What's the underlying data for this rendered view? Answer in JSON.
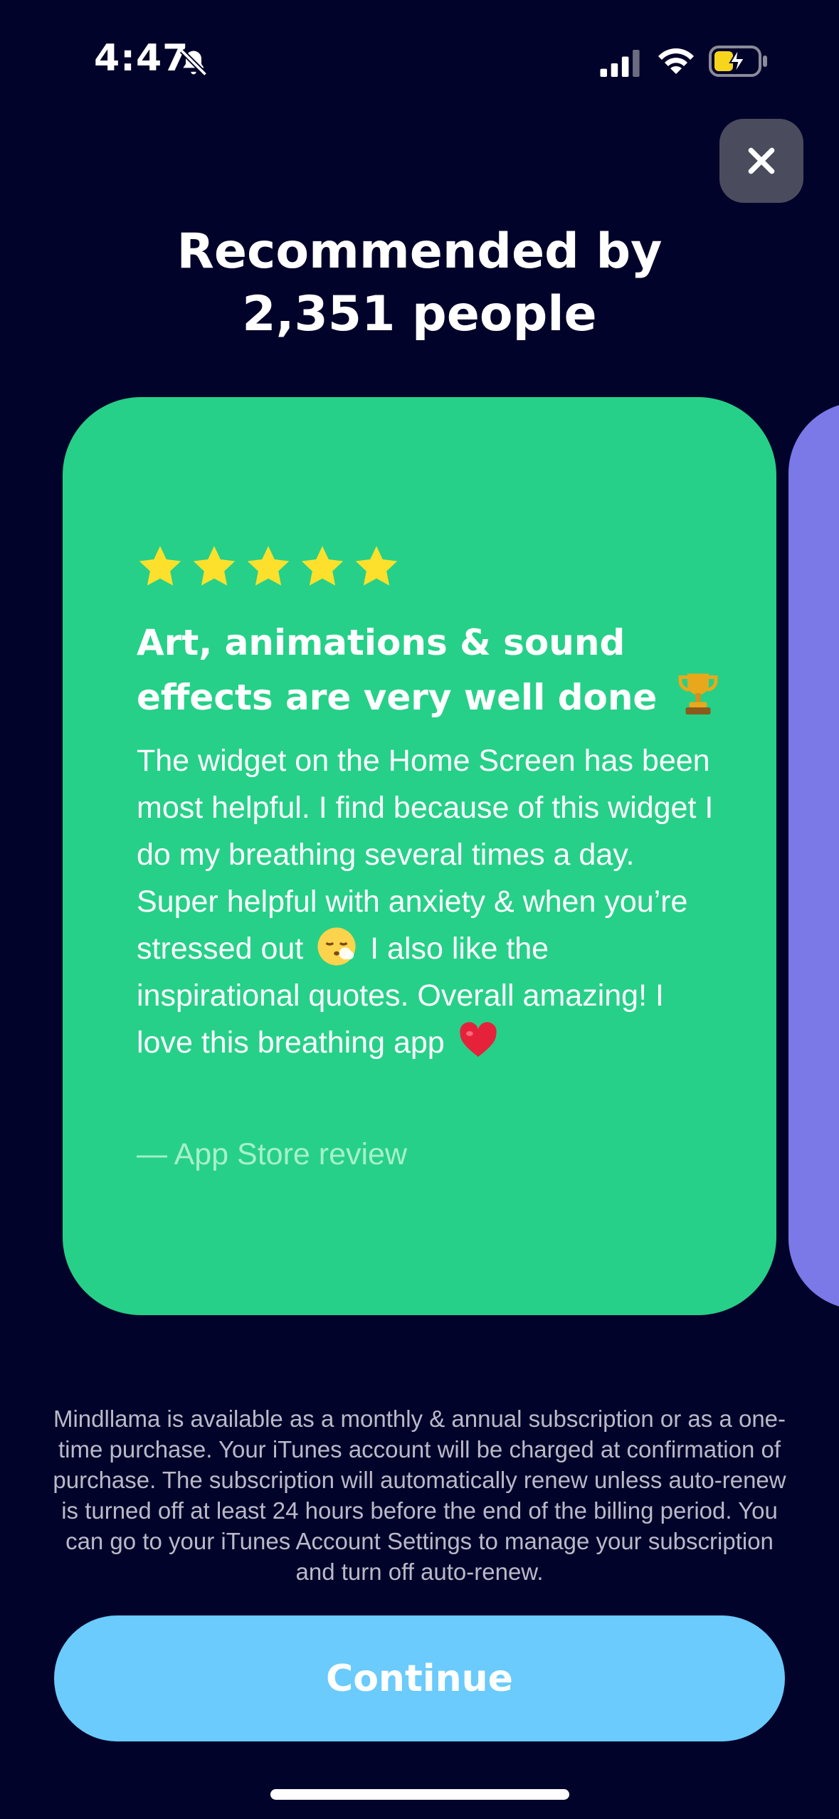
{
  "status_bar": {
    "time": "4:47",
    "icons": [
      "bell-slash-icon",
      "signal-icon",
      "wifi-icon",
      "battery-charging-icon"
    ],
    "battery_color": "#f7d51d"
  },
  "close": {
    "icon": "close-icon"
  },
  "header": {
    "title_line1": "Recommended by",
    "title_line2": "2,351 people"
  },
  "review": {
    "rating": 5,
    "rating_max": 5,
    "title": "Art, animations & sound effects are very well done",
    "title_icon": "trophy-icon",
    "body_line1": "The widget on the Home Screen has been most helpful. I find because of this widget I do my breathing several times a day.",
    "body_line2_a": "Super helpful with anxiety & when you’re stressed out",
    "body_line2_b": "I also like the inspirational quotes. Overall amazing! I love this breathing app",
    "emoji_1": "relieved-face-icon",
    "emoji_2": "red-heart-icon",
    "source": "— App Store review",
    "card_color": "#26d088",
    "next_card_color": "#7b78e8"
  },
  "legal": {
    "text": "Mindllama is available as a monthly & annual subscription or as a one-time purchase. Your iTunes account will be charged at confirmation of purchase. The subscription will automatically renew unless auto-renew is turned off at least 24 hours before the end of the billing period. You can go to your iTunes Account Settings to manage your subscription and turn off auto-renew."
  },
  "footer": {
    "continue_label": "Continue",
    "button_color": "#6acbfc"
  },
  "colors": {
    "background": "#02032a",
    "star": "#fde02c"
  }
}
